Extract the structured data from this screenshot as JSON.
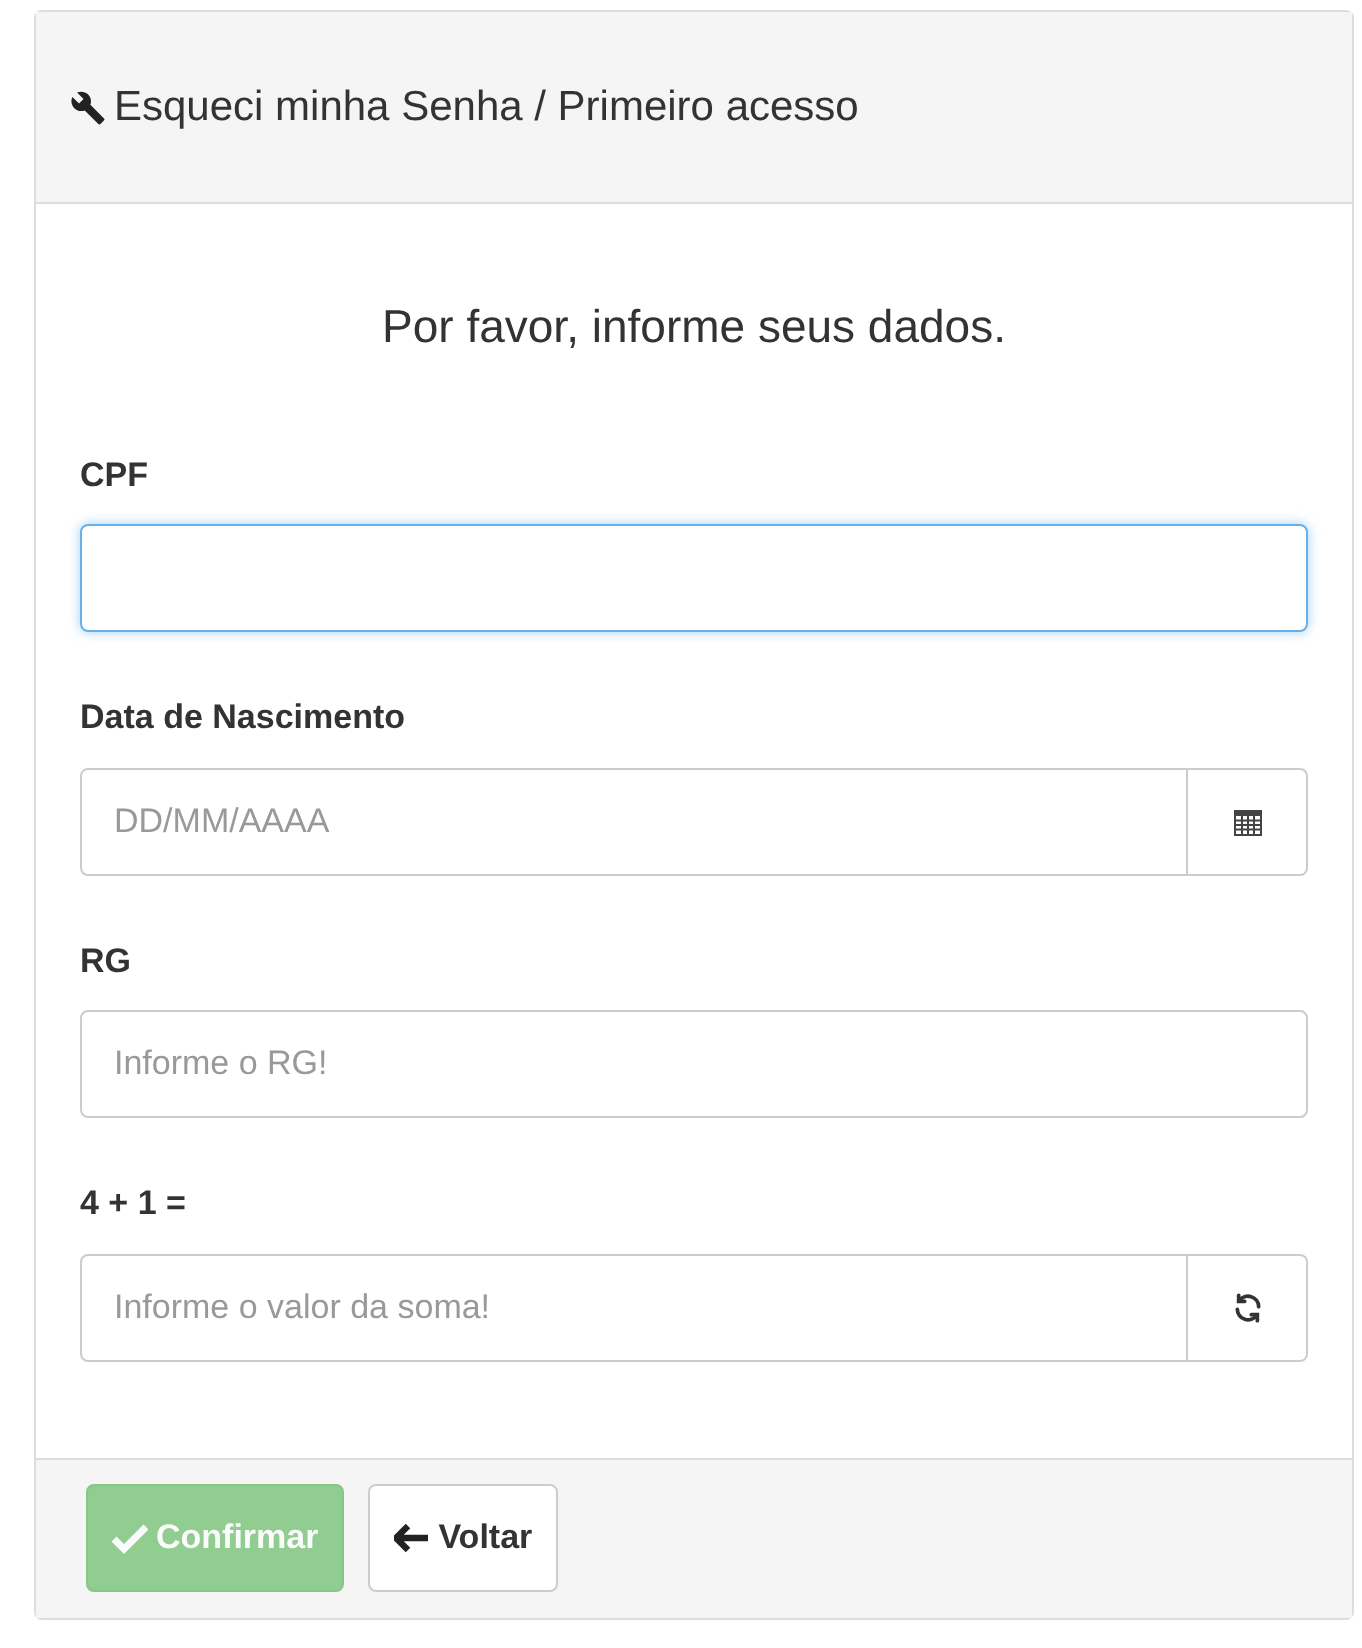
{
  "panel": {
    "title": "Esqueci minha Senha / Primeiro acesso"
  },
  "intro": "Por favor, informe seus dados.",
  "fields": [
    {
      "kind": "text",
      "label": "CPF",
      "focused": true
    },
    {
      "kind": "date",
      "label": "Data de Nascimento",
      "placeholder": "DD/MM/AAAA",
      "focused": false
    },
    {
      "kind": "text",
      "label": "RG",
      "placeholder": "Informe o RG!",
      "focused": false
    },
    {
      "kind": "captcha",
      "label": "4 + 1 =",
      "placeholder": "Informe o valor da soma!",
      "focused": false
    }
  ],
  "buttons": [
    {
      "kind": "confirm",
      "label": "Confirmar",
      "disabled": true
    },
    {
      "kind": "back",
      "label": "Voltar",
      "disabled": false
    }
  ]
}
